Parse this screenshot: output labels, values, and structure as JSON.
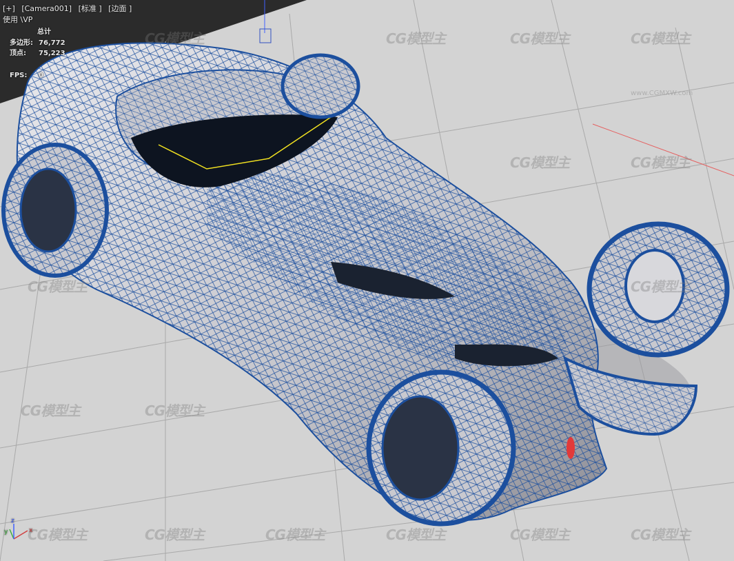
{
  "viewport_menu": {
    "plus_label": "[+]",
    "camera_label": "[Camera001]",
    "shading_label": "[标准 ]",
    "edge_label": "[边面 ]",
    "vp_label": "使用 \\VP"
  },
  "stats": {
    "header": "总计",
    "polygons_label": "多边形:",
    "polygons_value": "76,772",
    "vertices_label": "顶点:",
    "vertices_value": "75,223",
    "fps_label": "FPS:",
    "fps_value": "0"
  },
  "watermark": {
    "logo_text": "CG模型主",
    "url_text": "www.CGMXW.com"
  },
  "axis": {
    "x_label": "x",
    "y_label": "y",
    "z_label": "z"
  },
  "colors": {
    "background": "#2b2b2b",
    "grid_plane": "#d2d2d2",
    "grid_line": "#a8a8a8",
    "wireframe": "#1c4f9e",
    "mesh_surface": "#c9c9cf",
    "selection_red": "#e23a3a",
    "highlight_yellow": "#f0e020"
  }
}
